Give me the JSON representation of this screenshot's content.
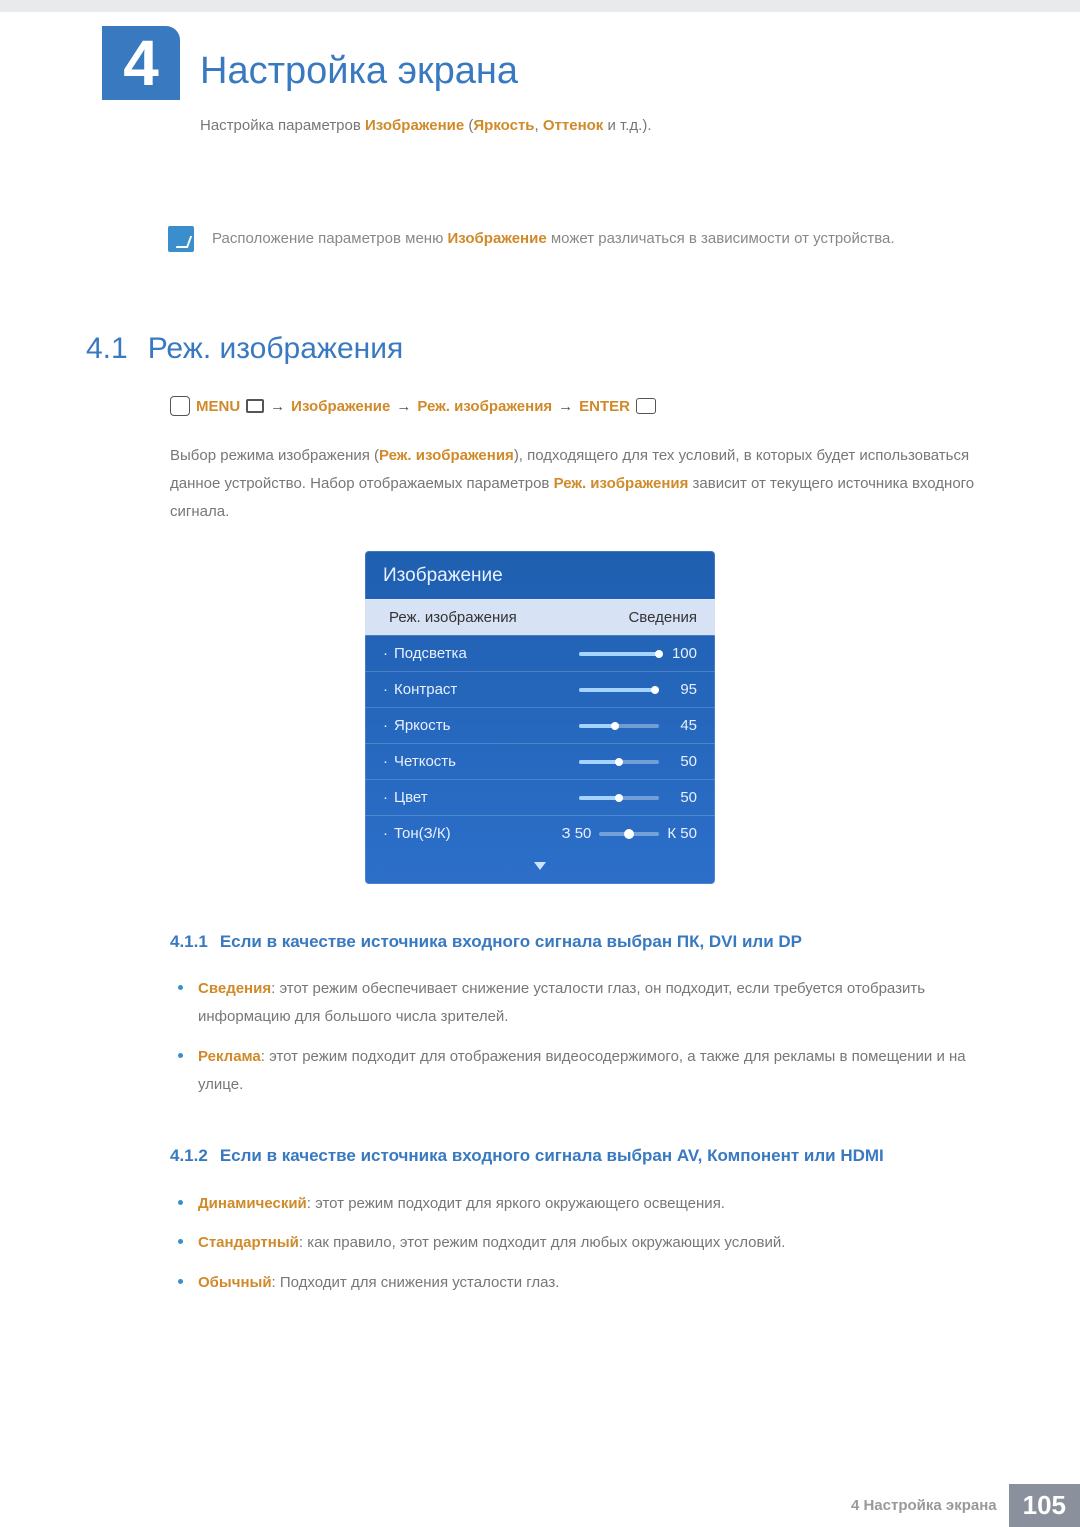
{
  "chapter": {
    "number": "4",
    "title": "Настройка экрана"
  },
  "subtitle": {
    "prefix": "Настройка параметров ",
    "hl1": "Изображение",
    "mid1": " (",
    "hl2": "Яркость",
    "mid2": ", ",
    "hl3": "Оттенок",
    "suffix": " и т.д.)."
  },
  "note": {
    "prefix": "Расположение параметров меню ",
    "hl": "Изображение",
    "suffix": " может различаться в зависимости от устройства."
  },
  "section41": {
    "num": "4.1",
    "title": "Реж. изображения"
  },
  "navpath": {
    "menu": "MENU",
    "arrow": "→",
    "item1": "Изображение",
    "item2": "Реж. изображения",
    "enter": "ENTER"
  },
  "para41": {
    "t1": "Выбор режима изображения (",
    "hl1": "Реж. изображения",
    "t2": "), подходящего для тех условий, в которых будет использоваться данное устройство. Набор отображаемых параметров ",
    "hl2": "Реж. изображения",
    "t3": " зависит от текущего источника входного сигнала."
  },
  "osd": {
    "title": "Изображение",
    "modeRow": {
      "label": "Реж. изображения",
      "value": "Сведения"
    },
    "rows": [
      {
        "label": "Подсветка",
        "value": "100",
        "pct": 100
      },
      {
        "label": "Контраст",
        "value": "95",
        "pct": 95
      },
      {
        "label": "Яркость",
        "value": "45",
        "pct": 45
      },
      {
        "label": "Четкость",
        "value": "50",
        "pct": 50
      },
      {
        "label": "Цвет",
        "value": "50",
        "pct": 50
      }
    ],
    "tint": {
      "label": "Тон(З/К)",
      "left": "З 50",
      "right": "К 50"
    }
  },
  "sub411": {
    "num": "4.1.1",
    "title": "Если в качестве источника входного сигнала выбран ПК, DVI или DP",
    "bullets": [
      {
        "hl": "Сведения",
        "text": ": этот режим обеспечивает снижение усталости глаз, он подходит, если требуется отобразить информацию для большого числа зрителей."
      },
      {
        "hl": "Реклама",
        "text": ": этот режим подходит для отображения видеосодержимого, а также для рекламы в помещении и на улице."
      }
    ]
  },
  "sub412": {
    "num": "4.1.2",
    "title": "Если в качестве источника входного сигнала выбран AV, Компонент или HDMI",
    "bullets": [
      {
        "hl": "Динамический",
        "text": ": этот режим подходит для яркого окружающего освещения."
      },
      {
        "hl": "Стандартный",
        "text": ": как правило, этот режим подходит для любых окружающих условий."
      },
      {
        "hl": "Обычный",
        "text": ": Подходит для снижения усталости глаз."
      }
    ]
  },
  "footer": {
    "label": "4 Настройка экрана",
    "page": "105"
  }
}
